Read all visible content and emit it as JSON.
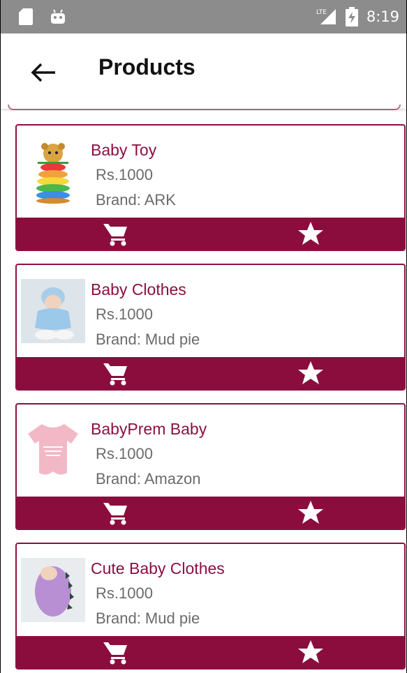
{
  "status_bar": {
    "time": "8:19",
    "network": "LTE",
    "icons": [
      "sd-card-icon",
      "android-icon",
      "lte-signal-icon",
      "battery-charging-icon"
    ]
  },
  "app_bar": {
    "title": "Products",
    "back_icon": "arrow-back-icon"
  },
  "colors": {
    "accent": "#8b0d3e",
    "status_bar": "#8c8c8c",
    "text_secondary": "#6b6b6b"
  },
  "products": [
    {
      "name": "Baby Toy",
      "price": "Rs.1000",
      "brand": "Brand: ARK",
      "thumb": "stacking-ring-toy"
    },
    {
      "name": "Baby Clothes",
      "price": "Rs.1000",
      "brand": "Brand: Mud pie",
      "thumb": "baby-in-blue-outfit"
    },
    {
      "name": "BabyPrem Baby",
      "price": "Rs.1000",
      "brand": "Brand: Amazon",
      "thumb": "pink-onesie"
    },
    {
      "name": "Cute Baby Clothes",
      "price": "Rs.1000",
      "brand": "Brand: Mud pie",
      "thumb": "baby-in-purple-dino-suit"
    }
  ],
  "card_actions": {
    "cart_icon": "shopping-cart-icon",
    "favorite_icon": "star-icon"
  }
}
